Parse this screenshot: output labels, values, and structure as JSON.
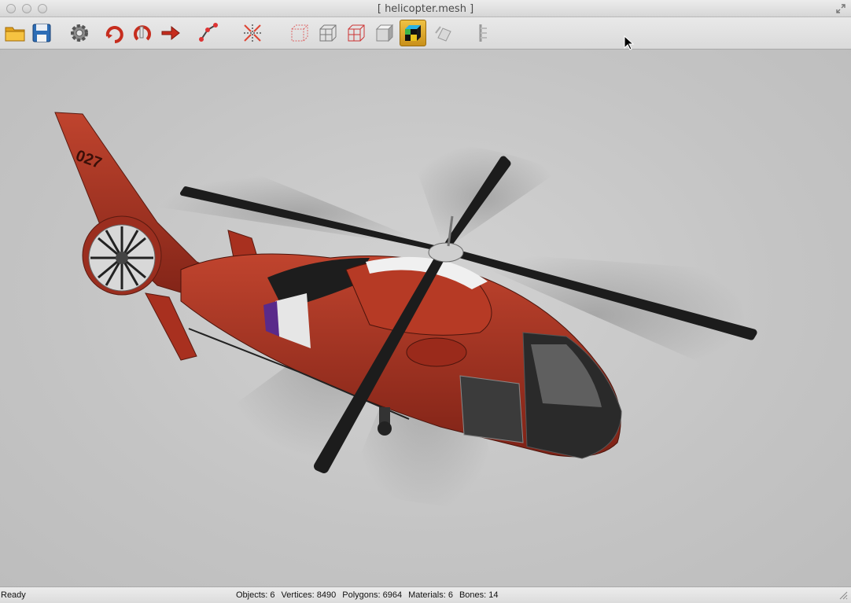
{
  "window": {
    "title": "[ helicopter.mesh ]"
  },
  "toolbar": {
    "buttons": [
      {
        "name": "open-folder",
        "icon": "folder-icon",
        "active": false
      },
      {
        "name": "save",
        "icon": "floppy-disk-icon",
        "active": false
      },
      {
        "name": "settings",
        "icon": "gear-icon",
        "active": false
      },
      {
        "name": "rotate",
        "icon": "rotate-arrow-icon",
        "active": false
      },
      {
        "name": "orbit",
        "icon": "orbit-arrow-icon",
        "active": false
      },
      {
        "name": "move",
        "icon": "move-arrow-icon",
        "active": false
      },
      {
        "name": "skeleton",
        "icon": "bone-icon",
        "active": false
      },
      {
        "name": "normals",
        "icon": "normals-icon",
        "active": false
      },
      {
        "name": "bounding-box",
        "icon": "bounding-box-icon",
        "active": false
      },
      {
        "name": "wireframe",
        "icon": "wireframe-cube-icon",
        "active": false
      },
      {
        "name": "wireframe-red",
        "icon": "wireframe-red-cube-icon",
        "active": false
      },
      {
        "name": "solid",
        "icon": "solid-cube-icon",
        "active": false
      },
      {
        "name": "textured",
        "icon": "textured-cube-icon",
        "active": true
      },
      {
        "name": "animation",
        "icon": "animation-icon",
        "active": false
      },
      {
        "name": "bones-list",
        "icon": "bone-hierarchy-icon",
        "active": false
      }
    ]
  },
  "viewport": {
    "background": "#c7c7c7",
    "model_colors": {
      "body": "#a8301f",
      "dark": "#1d1d1d",
      "white": "#e6e6e6",
      "purple": "#5a2a8a"
    },
    "tail_number": "027"
  },
  "status": {
    "state": "Ready",
    "objects": "Objects: 6",
    "vertices": "Vertices: 8490",
    "polygons": "Polygons: 6964",
    "materials": "Materials: 6",
    "bones": "Bones: 14"
  }
}
